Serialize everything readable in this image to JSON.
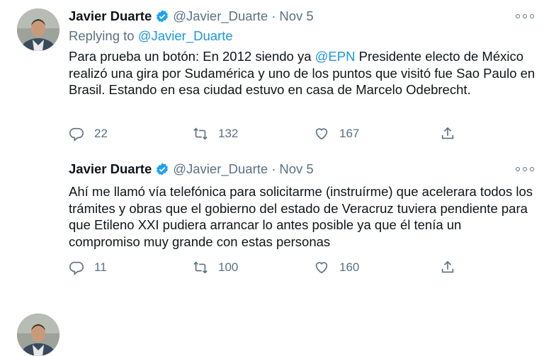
{
  "tweets": [
    {
      "author_name": "Javier Duarte",
      "author_handle": "@Javier_Duarte",
      "dot": "·",
      "date": "Nov 5",
      "reply_prefix": "Replying to ",
      "reply_to": "@Javier_Duarte",
      "text_before": "Para prueba un botón: En 2012 siendo ya ",
      "mention": "@EPN",
      "text_after": " Presidente electo de México realizó una gira por Sudamérica y uno de los puntos que visitó fue Sao Paulo en Brasil. Estando en esa ciudad estuvo en casa de Marcelo Odebrecht.",
      "replies": "22",
      "retweets": "132",
      "likes": "167"
    },
    {
      "author_name": "Javier Duarte",
      "author_handle": "@Javier_Duarte",
      "dot": "·",
      "date": "Nov 5",
      "text": "Ahí me llamó vía telefónica para solicitarme (instruírme) que acelerara todos los trámites y obras que el gobierno del estado de Veracruz tuviera pendiente para que Etileno XXI pudiera arrancar lo antes posible ya que él tenía un compromiso muy grande con estas personas",
      "replies": "11",
      "retweets": "100",
      "likes": "160"
    }
  ],
  "icons": {
    "verified": "verified-badge-icon",
    "more": "more-options-icon",
    "reply": "reply-icon",
    "retweet": "retweet-icon",
    "like": "heart-icon",
    "share": "share-icon"
  },
  "colors": {
    "text": "#0f1419",
    "secondary": "#5b7083",
    "link": "#1b95e0",
    "verified": "#1da1f2"
  }
}
